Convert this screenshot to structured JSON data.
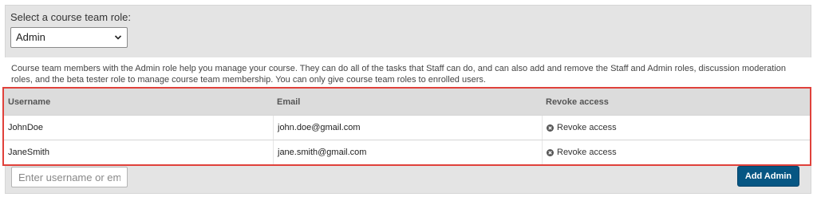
{
  "role_selector": {
    "label": "Select a course team role:",
    "selected": "Admin"
  },
  "description": "Course team members with the Admin role help you manage your course. They can do all of the tasks that Staff can do, and can also add and remove the Staff and Admin roles, discussion moderation roles, and the beta tester role to manage course team membership. You can only give course team roles to enrolled users.",
  "table": {
    "headers": [
      "Username",
      "Email",
      "Revoke access"
    ],
    "rows": [
      {
        "username": "JohnDoe",
        "email": "john.doe@gmail.com",
        "action": "Revoke access"
      },
      {
        "username": "JaneSmith",
        "email": "jane.smith@gmail.com",
        "action": "Revoke access"
      }
    ]
  },
  "add_form": {
    "input_placeholder": "Enter username or email",
    "button_label": "Add Admin"
  },
  "colors": {
    "highlight_border": "#e0413b",
    "button_bg": "#065683"
  },
  "icons": {
    "select_chevron": "chevron-down-icon",
    "revoke": "close-circle-icon"
  }
}
